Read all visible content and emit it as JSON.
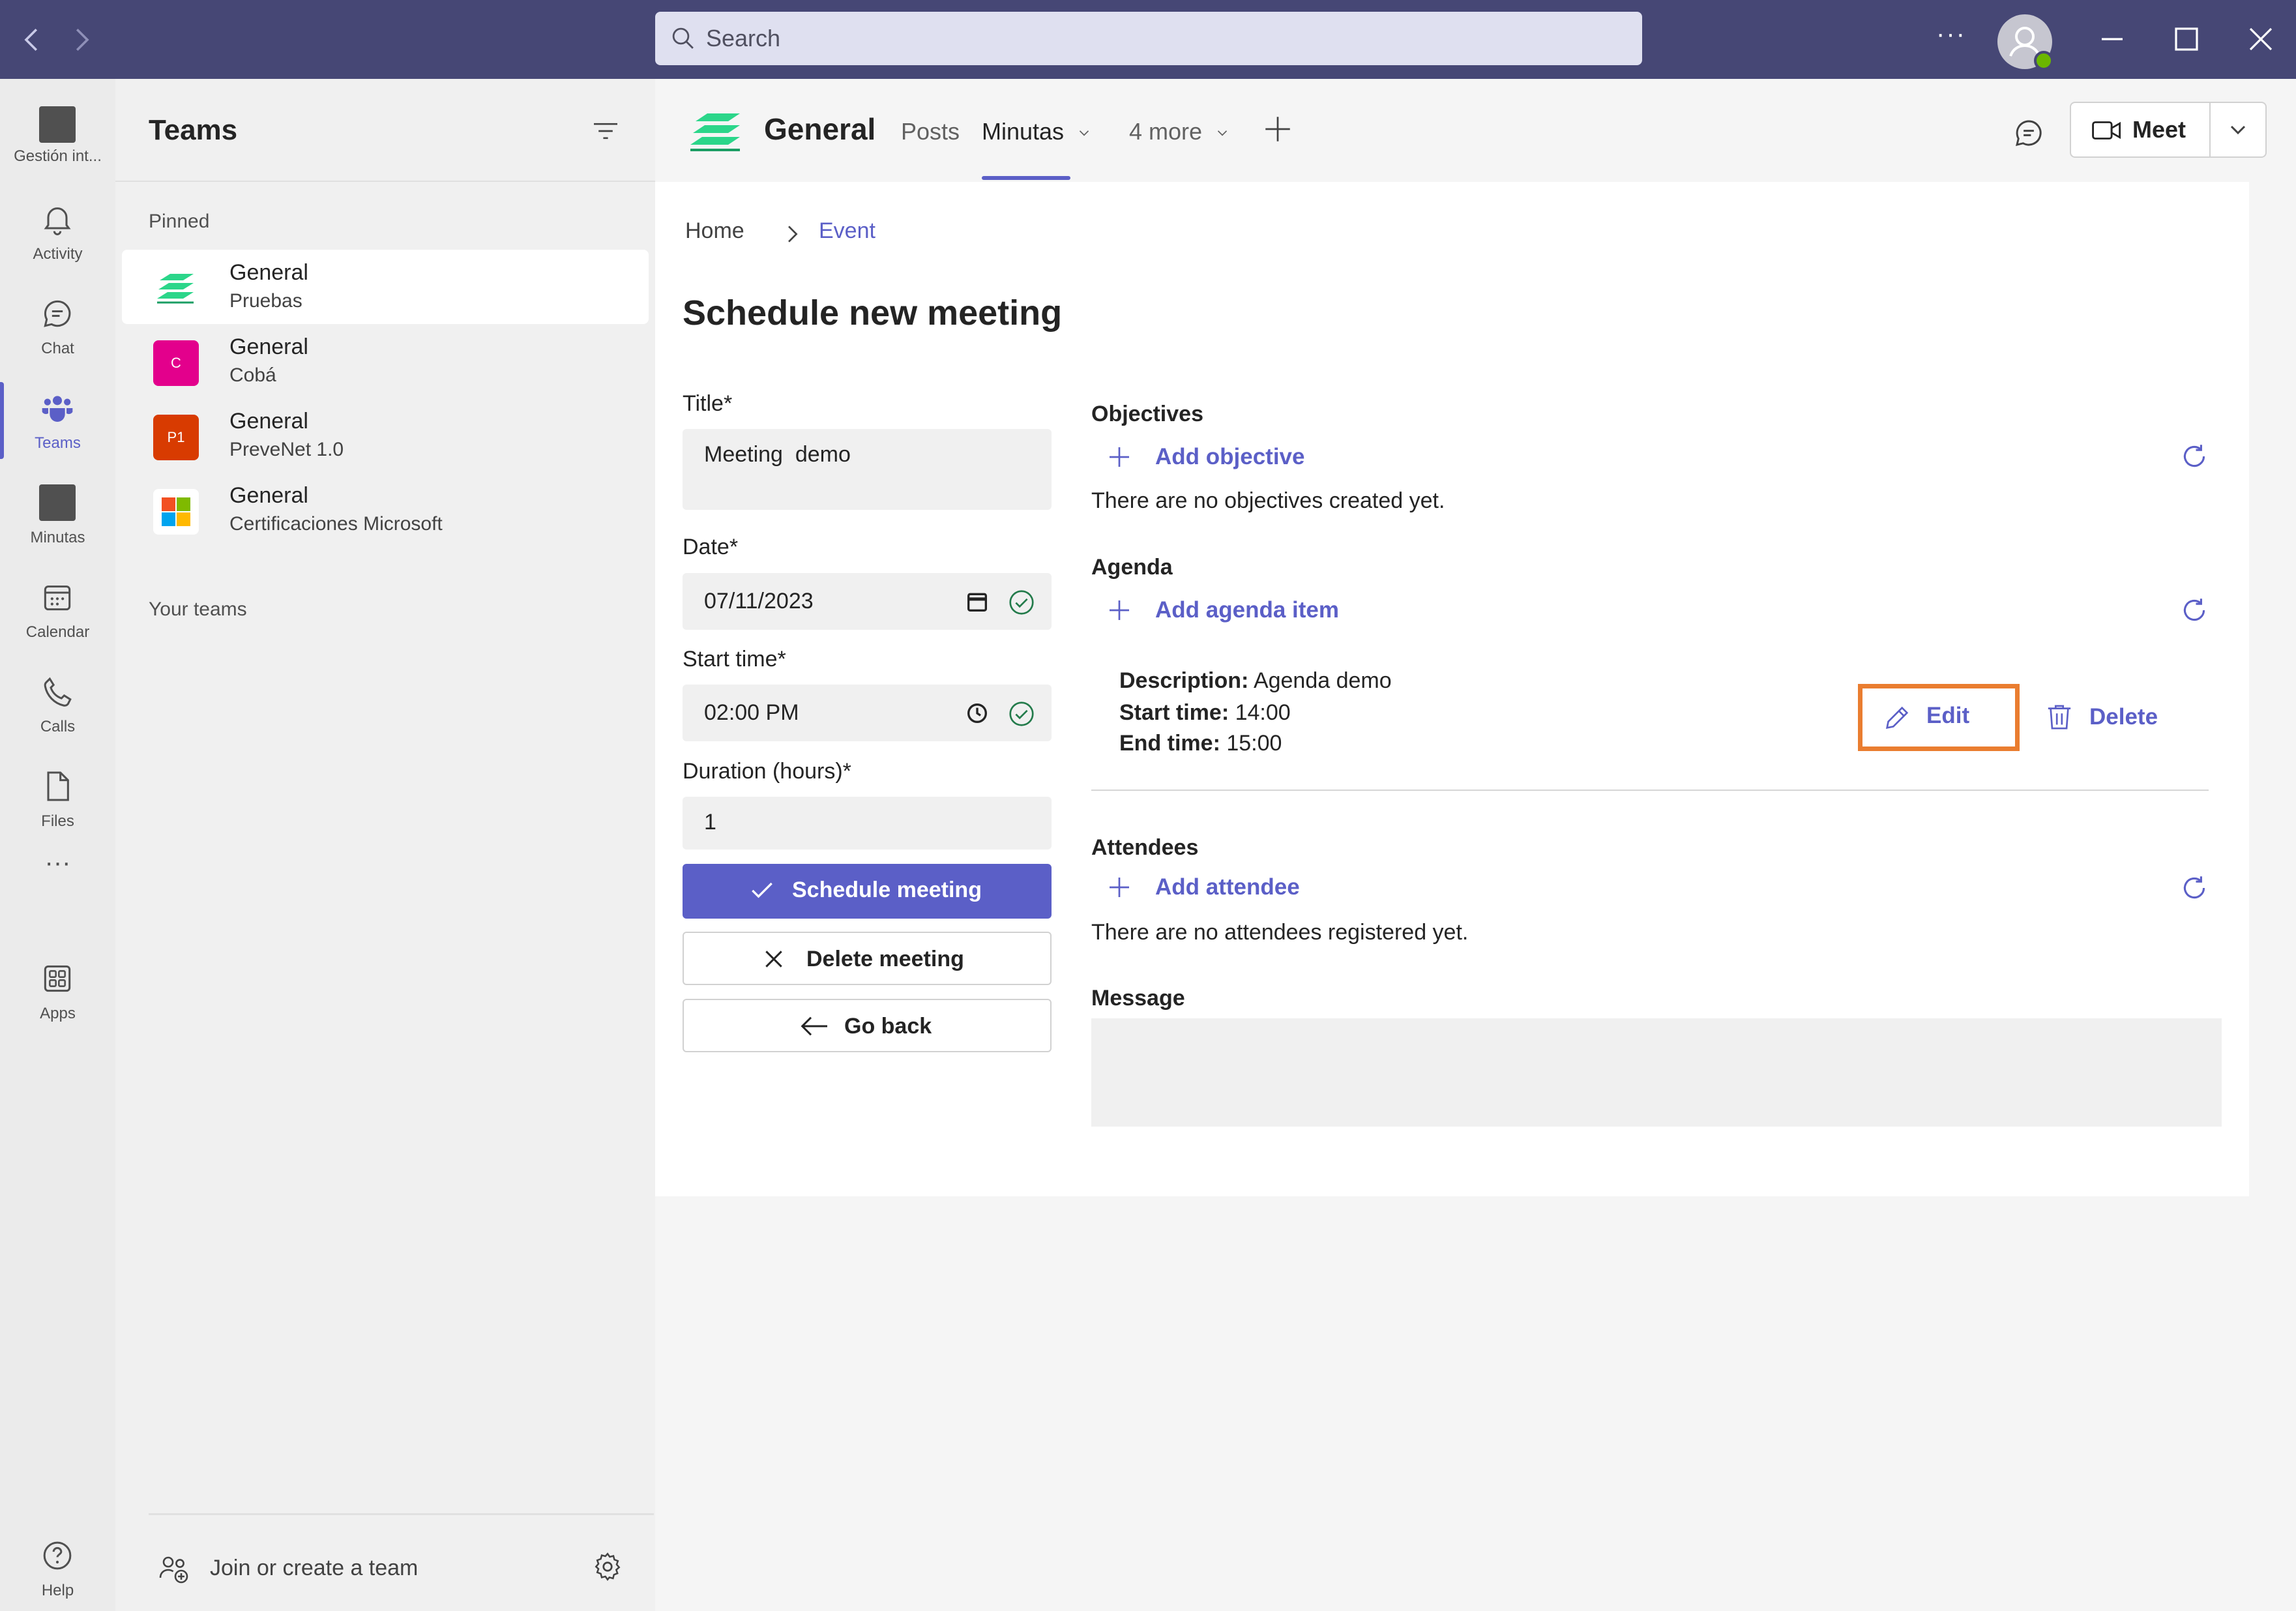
{
  "titlebar": {
    "search_placeholder": "Search",
    "more_label": "···"
  },
  "rail": {
    "items": [
      {
        "label": "Gestión int...",
        "icon": "app-tile-icon"
      },
      {
        "label": "Activity",
        "icon": "bell-icon"
      },
      {
        "label": "Chat",
        "icon": "chat-icon"
      },
      {
        "label": "Teams",
        "icon": "teams-icon",
        "active": true
      },
      {
        "label": "Minutas",
        "icon": "app-tile-icon"
      },
      {
        "label": "Calendar",
        "icon": "calendar-icon"
      },
      {
        "label": "Calls",
        "icon": "phone-icon"
      },
      {
        "label": "Files",
        "icon": "file-icon"
      },
      {
        "label": "Apps",
        "icon": "apps-icon"
      },
      {
        "label": "Help",
        "icon": "help-icon"
      }
    ],
    "more_label": "···"
  },
  "teams_pane": {
    "title": "Teams",
    "pinned_label": "Pinned",
    "your_teams_label": "Your teams",
    "teams": [
      {
        "name": "General",
        "team": "Pruebas",
        "avatar_text": "",
        "color": "#2bd68a"
      },
      {
        "name": "General",
        "team": "Cobá",
        "avatar_text": "C",
        "color": "#e3008c"
      },
      {
        "name": "General",
        "team": "PreveNet 1.0",
        "avatar_text": "P1",
        "color": "#d83b01"
      },
      {
        "name": "General",
        "team": "Certificaciones Microsoft",
        "avatar_text": "",
        "color": "#ffffff"
      }
    ],
    "join_label": "Join or create a team"
  },
  "header": {
    "channel_name": "General",
    "tabs": [
      {
        "label": "Posts"
      },
      {
        "label": "Minutas",
        "active": true
      },
      {
        "label": "4 more"
      }
    ],
    "meet_label": "Meet"
  },
  "breadcrumb": {
    "home": "Home",
    "current": "Event"
  },
  "form": {
    "page_title": "Schedule new meeting",
    "title_label": "Title*",
    "title_value": "Meeting  demo",
    "date_label": "Date*",
    "date_value": "07/11/2023",
    "start_label": "Start time*",
    "start_value": "02:00 PM",
    "duration_label": "Duration (hours)*",
    "duration_value": "1",
    "schedule_btn": "Schedule meeting",
    "delete_btn": "Delete meeting",
    "back_btn": "Go back"
  },
  "objectives": {
    "title": "Objectives",
    "add_label": "Add objective",
    "empty_text": "There are no objectives created yet."
  },
  "agenda": {
    "title": "Agenda",
    "add_label": "Add agenda item",
    "item": {
      "description_label": "Description:",
      "description": "Agenda demo",
      "start_label": "Start time:",
      "start": "14:00",
      "end_label": "End time:",
      "end": "15:00"
    },
    "edit_label": "Edit",
    "delete_label": "Delete"
  },
  "attendees": {
    "title": "Attendees",
    "add_label": "Add attendee",
    "empty_text": "There are no attendees registered yet."
  },
  "message": {
    "title": "Message"
  },
  "colors": {
    "titlebar": "#464775",
    "accent": "#5b5fc7",
    "highlight": "#ea7d30",
    "success": "#237b4b"
  }
}
